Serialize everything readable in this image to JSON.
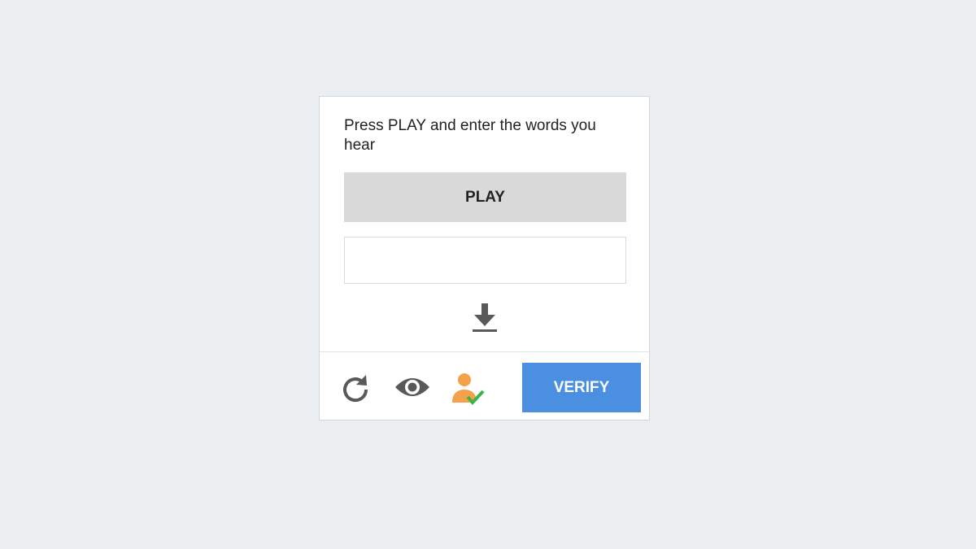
{
  "captcha": {
    "instruction": "Press PLAY and enter the words you hear",
    "play_label": "PLAY",
    "answer_value": "",
    "verify_label": "VERIFY"
  },
  "icons": {
    "download": "download-icon",
    "refresh": "refresh-icon",
    "view": "eye-icon",
    "accessibility": "person-check-icon"
  },
  "colors": {
    "background": "#ebeef0",
    "play_button": "#d9d9d9",
    "verify_button": "#4a8fe0",
    "icon_gray": "#595959",
    "accessibility_orange": "#f5a04a",
    "check_green": "#3cb44a"
  }
}
